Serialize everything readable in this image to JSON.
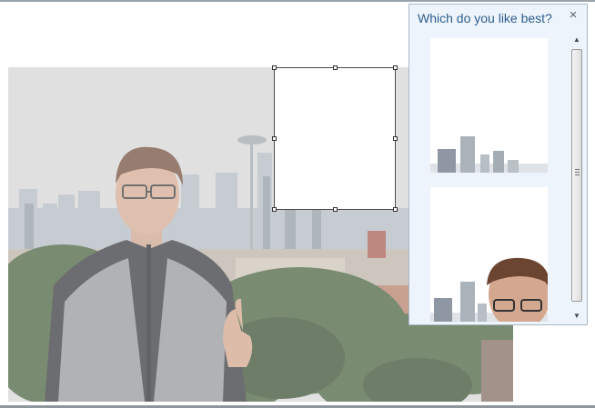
{
  "panel": {
    "title": "Which do you like best?",
    "close_icon": "×",
    "scroll_up_icon": "▲",
    "scroll_down_icon": "▼"
  },
  "colors": {
    "panel_background": "#eef4fb",
    "panel_title": "#2b5d8f",
    "selection_border": "#4a4a4a"
  },
  "icons": [
    "close-icon",
    "scroll-up-icon",
    "scroll-down-icon",
    "scroll-thumb-grip-icon"
  ]
}
